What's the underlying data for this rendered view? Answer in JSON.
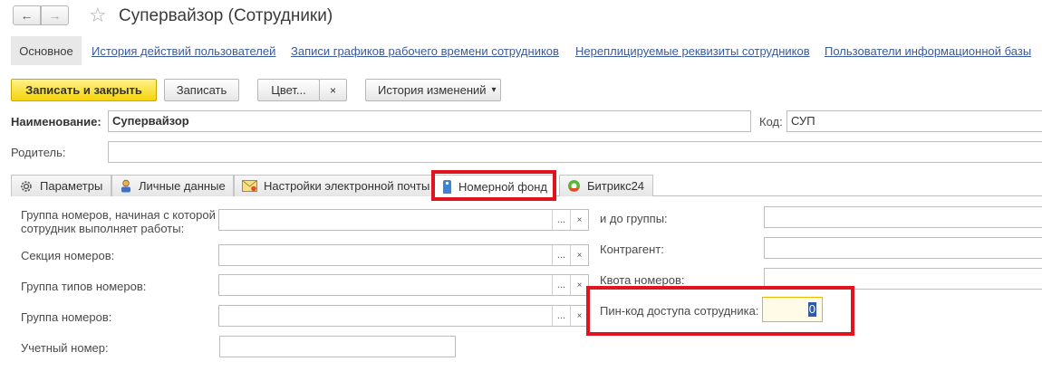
{
  "window": {
    "title": "Супервайзор (Сотрудники)",
    "icons": [
      "arrow-left-icon",
      "arrow-right-icon",
      "star-icon"
    ]
  },
  "sections": {
    "active": "Основное",
    "links": [
      "История действий пользователей",
      "Записи графиков рабочего времени сотрудников",
      "Нереплицируемые реквизиты сотрудников",
      "Пользователи информационной базы"
    ]
  },
  "toolbar": {
    "save_close": "Записать и закрыть",
    "save": "Записать",
    "color": "Цвет...",
    "clear": "×",
    "history": "История изменений",
    "history_arrow": "▾"
  },
  "header": {
    "name_label": "Наименование:",
    "name_value": "Супервайзор",
    "code_label": "Код:",
    "code_value": "СУП",
    "parent_label": "Родитель:",
    "parent_value": ""
  },
  "tabs": [
    {
      "label": "Параметры",
      "icon": "gear-icon"
    },
    {
      "label": "Личные данные",
      "icon": "person-icon"
    },
    {
      "label": "Настройки электронной почты",
      "icon": "envelope-icon"
    },
    {
      "label": "Номерной фонд",
      "icon": "door-tag-icon",
      "active": true
    },
    {
      "label": "Битрикс24",
      "icon": "bitrix-icon"
    }
  ],
  "form": {
    "group_from_label": "Группа номеров, начиная с которой сотрудник выполняет работы:",
    "group_to_label": "и до группы:",
    "section_label": "Секция номеров:",
    "counterparty_label": "Контрагент:",
    "room_type_group_label": "Группа типов номеров:",
    "quota_label": "Квота номеров:",
    "room_group_label": "Группа номеров:",
    "pin_label": "Пин-код доступа сотрудника:",
    "pin_value": "0",
    "account_label": "Учетный номер:",
    "select_dots": "...",
    "select_clear": "×"
  },
  "colors": {
    "primary_button": "#f5d30a",
    "link": "#3b5a9a",
    "highlight": "#e0141e",
    "pin_border": "#e9b700"
  }
}
